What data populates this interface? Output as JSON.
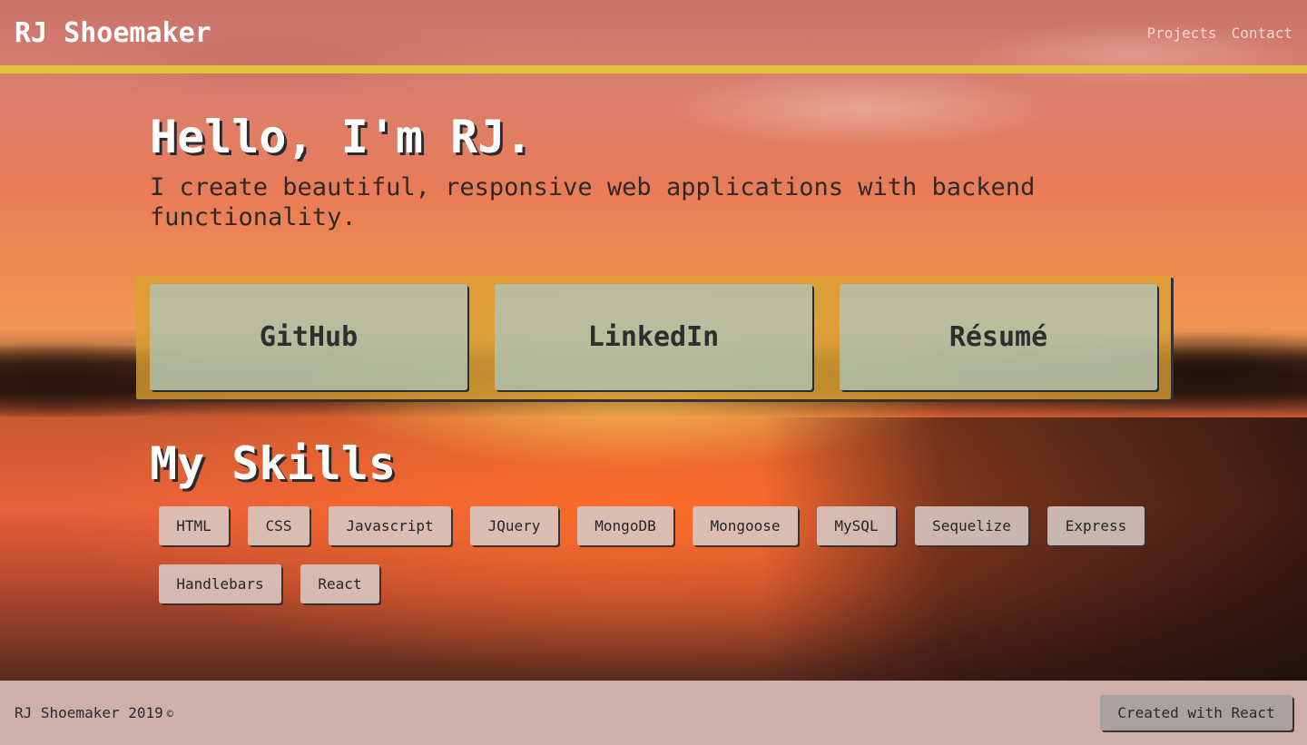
{
  "header": {
    "brand": "RJ Shoemaker",
    "nav": [
      "Projects",
      "Contact"
    ]
  },
  "hero": {
    "title": "Hello, I'm RJ.",
    "subtitle": "I create beautiful, responsive web applications with backend functionality."
  },
  "links": [
    "GitHub",
    "LinkedIn",
    "Résumé"
  ],
  "skills": {
    "title": "My Skills",
    "items": [
      "HTML",
      "CSS",
      "Javascript",
      "JQuery",
      "MongoDB",
      "Mongoose",
      "MySQL",
      "Sequelize",
      "Express",
      "Handlebars",
      "React"
    ]
  },
  "footer": {
    "text": "RJ Shoemaker 2019",
    "copyright_symbol": "©",
    "button": "Created with React"
  },
  "colors": {
    "accent_bar": "#e2c43a",
    "footer_bg": "#cdb0ac",
    "link_panel": "#daa032"
  }
}
